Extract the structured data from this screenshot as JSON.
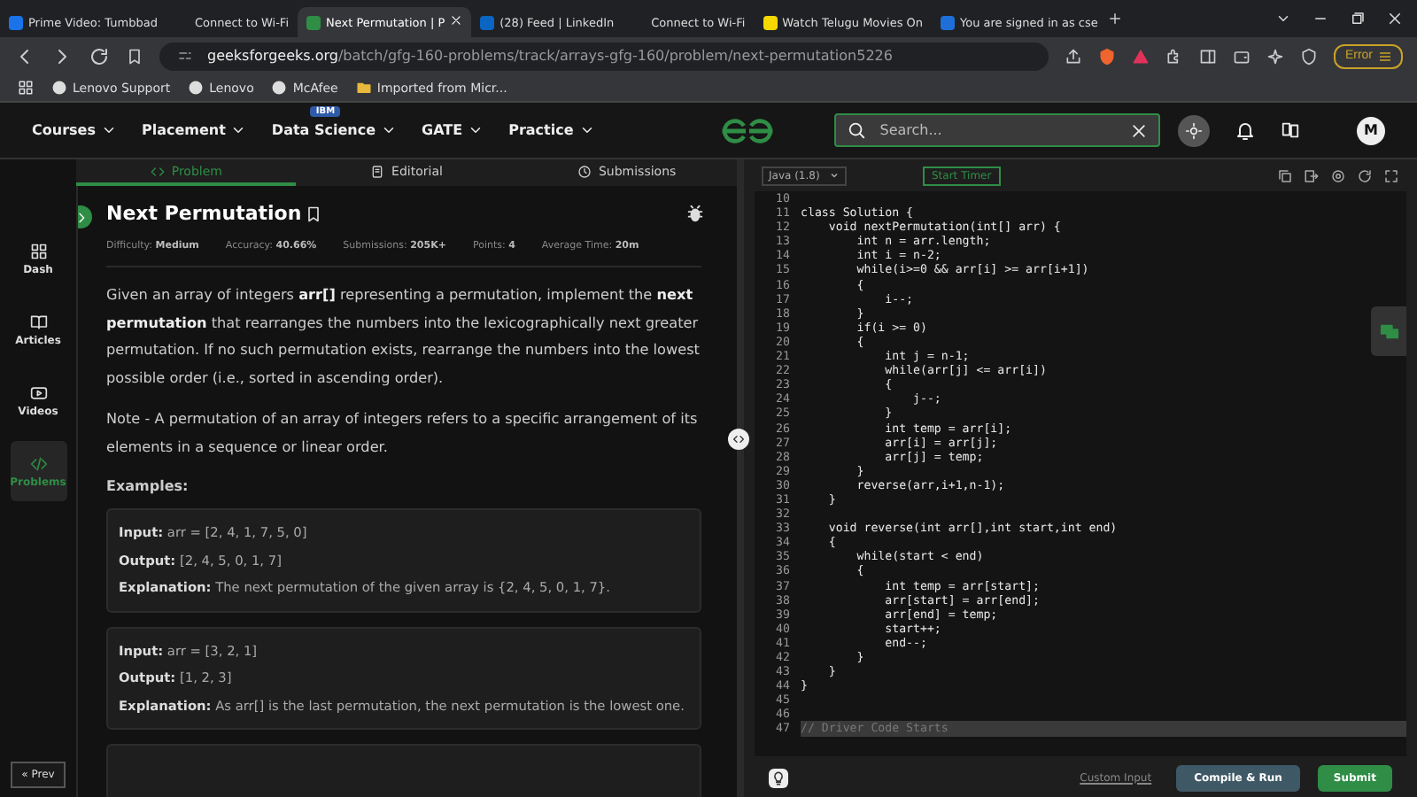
{
  "browser": {
    "tabs": [
      {
        "title": "Prime Video: Tumbbad",
        "selected": false,
        "color": "#1a73e8"
      },
      {
        "title": "Connect to Wi-Fi",
        "selected": false
      },
      {
        "title": "Next Permutation | P",
        "selected": true,
        "color": "#2f8d46"
      },
      {
        "title": "(28) Feed | LinkedIn",
        "selected": false,
        "color": "#0a66c2"
      },
      {
        "title": "Connect to Wi-Fi",
        "selected": false
      },
      {
        "title": "Watch Telugu Movies On",
        "selected": false,
        "color": "#f5d800"
      },
      {
        "title": "You are signed in as cse",
        "selected": false,
        "color": "#1e6fd9"
      }
    ],
    "address": {
      "domain": "geeksforgeeks.org",
      "path": "/batch/gfg-160-problems/track/arrays-gfg-160/problem/next-permutation5226"
    },
    "error_button": "Error",
    "bookmarks": [
      "Lenovo Support",
      "Lenovo",
      "McAfee",
      "Imported from Micr..."
    ]
  },
  "nav": {
    "items": [
      {
        "label": "Courses"
      },
      {
        "label": "Placement"
      },
      {
        "label": "Data Science",
        "badge": "IBM"
      },
      {
        "label": "GATE"
      },
      {
        "label": "Practice"
      }
    ],
    "search": {
      "placeholder": "Search..."
    },
    "avatar": "M"
  },
  "problem_tabs": [
    {
      "label": "Problem",
      "selected": true
    },
    {
      "label": "Editorial",
      "selected": false
    },
    {
      "label": "Submissions",
      "selected": false
    }
  ],
  "sidebar": {
    "items": [
      {
        "label": "Dash",
        "selected": false
      },
      {
        "label": "Articles",
        "selected": false
      },
      {
        "label": "Videos",
        "selected": false
      },
      {
        "label": "Problems",
        "selected": true
      }
    ],
    "prev": "« Prev"
  },
  "problem": {
    "title": "Next Permutation",
    "meta": [
      {
        "label": "Difficulty:",
        "value": "Medium"
      },
      {
        "label": "Accuracy:",
        "value": "40.66%"
      },
      {
        "label": "Submissions:",
        "value": "205K+"
      },
      {
        "label": "Points:",
        "value": "4"
      },
      {
        "label": "Average Time:",
        "value": "20m"
      }
    ],
    "paragraphs": [
      "Given an array of integers **arr[]** representing a permutation, implement the **next permutation** that rearranges the numbers into the lexicographically next greater permutation. If no such permutation exists, rearrange the numbers into the lowest possible order (i.e., sorted in ascending order).",
      "Note - A permutation of an array of integers refers to a specific arrangement of its elements in a sequence or linear order."
    ],
    "examples_heading": "Examples:",
    "examples": [
      [
        {
          "label": "Input:",
          "text": "arr = [2, 4, 1, 7, 5, 0]"
        },
        {
          "label": "Output:",
          "text": "[2, 4, 5, 0, 1, 7]"
        },
        {
          "label": "Explanation:",
          "text": "The next permutation of the given array is {2, 4, 5, 0, 1, 7}."
        }
      ],
      [
        {
          "label": "Input:",
          "text": "arr = [3, 2, 1]"
        },
        {
          "label": "Output:",
          "text": "[1, 2, 3]"
        },
        {
          "label": "Explanation:",
          "text": "As arr[] is the last permutation, the next permutation is the lowest one."
        }
      ]
    ]
  },
  "editor": {
    "language": "Java (1.8)",
    "timer": "Start Timer",
    "lines": [
      {
        "n": "10"
      },
      {
        "n": "11",
        "code": "class Solution {"
      },
      {
        "n": "12",
        "code": "    void nextPermutation(int[] arr) {"
      },
      {
        "n": "13",
        "code": "        int n = arr.length;"
      },
      {
        "n": "14",
        "code": "        int i = n-2;"
      },
      {
        "n": "15",
        "code": "        while(i>=0 && arr[i] >= arr[i+1])"
      },
      {
        "n": "16",
        "code": "        {"
      },
      {
        "n": "17",
        "code": "            i--;"
      },
      {
        "n": "18",
        "code": "        }"
      },
      {
        "n": "19",
        "code": "        if(i >= 0)"
      },
      {
        "n": "20",
        "code": "        {"
      },
      {
        "n": "21",
        "code": "            int j = n-1;"
      },
      {
        "n": "22",
        "code": "            while(arr[j] <= arr[i])"
      },
      {
        "n": "23",
        "code": "            {"
      },
      {
        "n": "24",
        "code": "                j--;"
      },
      {
        "n": "25",
        "code": "            }"
      },
      {
        "n": "26",
        "code": "            int temp = arr[i];"
      },
      {
        "n": "27",
        "code": "            arr[i] = arr[j];"
      },
      {
        "n": "28",
        "code": "            arr[j] = temp;"
      },
      {
        "n": "29",
        "code": "        }"
      },
      {
        "n": "30",
        "code": "        reverse(arr,i+1,n-1);"
      },
      {
        "n": "31",
        "code": "    }"
      },
      {
        "n": "32"
      },
      {
        "n": "33",
        "code": "    void reverse(int arr[],int start,int end)"
      },
      {
        "n": "34",
        "code": "    {"
      },
      {
        "n": "35",
        "code": "        while(start < end)"
      },
      {
        "n": "36",
        "code": "        {"
      },
      {
        "n": "37",
        "code": "            int temp = arr[start];"
      },
      {
        "n": "38",
        "code": "            arr[start] = arr[end];"
      },
      {
        "n": "39",
        "code": "            arr[end] = temp;"
      },
      {
        "n": "40",
        "code": "            start++;"
      },
      {
        "n": "41",
        "code": "            end--;"
      },
      {
        "n": "42",
        "code": "        }"
      },
      {
        "n": "43",
        "code": "    }"
      },
      {
        "n": "44",
        "code": "}"
      },
      {
        "n": "45"
      },
      {
        "n": "46"
      },
      {
        "n": "47",
        "code": "// Driver Code Starts"
      }
    ],
    "custom_input": "Custom Input",
    "compile": "Compile & Run",
    "submit": "Submit"
  }
}
